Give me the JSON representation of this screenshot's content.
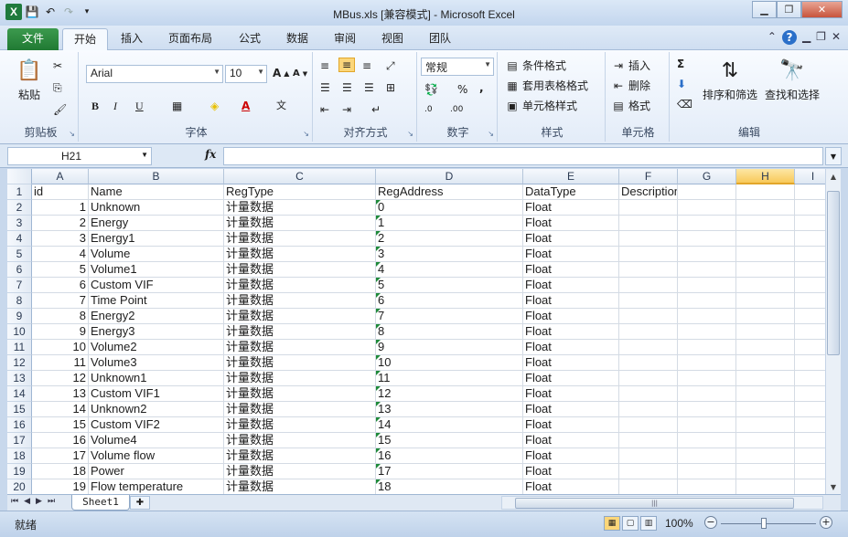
{
  "window": {
    "title": "MBus.xls  [兼容模式]  -  Microsoft Excel",
    "logo": "X"
  },
  "tabs": {
    "file": "文件",
    "items": [
      "开始",
      "插入",
      "页面布局",
      "公式",
      "数据",
      "审阅",
      "视图",
      "团队"
    ]
  },
  "ribbon": {
    "clipboard": {
      "label": "剪贴板",
      "paste": "粘贴"
    },
    "font": {
      "label": "字体",
      "name": "Arial",
      "size": "10",
      "bold": "B",
      "italic": "I",
      "underline": "U"
    },
    "alignment": {
      "label": "对齐方式"
    },
    "number": {
      "label": "数字",
      "format": "常规",
      "percent": "%",
      "comma": ","
    },
    "styles": {
      "label": "样式",
      "conditional": "条件格式",
      "table": "套用表格格式",
      "cell_styles": "单元格样式"
    },
    "cells": {
      "label": "单元格",
      "insert": "插入",
      "delete": "删除",
      "format": "格式"
    },
    "editing": {
      "label": "编辑",
      "sort": "排序和筛选",
      "find": "查找和选择"
    }
  },
  "formula_bar": {
    "name_box": "H21",
    "fx": "fx",
    "value": ""
  },
  "grid": {
    "columns": [
      "A",
      "B",
      "C",
      "D",
      "E",
      "F",
      "G",
      "H",
      "I"
    ],
    "selected_column": "H",
    "rows": [
      {
        "n": "1",
        "a": "id",
        "b": "Name",
        "c": "RegType",
        "d": "RegAddress",
        "e": "DataType",
        "f": "Description"
      },
      {
        "n": "2",
        "a": "1",
        "b": "Unknown",
        "c": "计量数据",
        "d": "0",
        "e": "Float"
      },
      {
        "n": "3",
        "a": "2",
        "b": "Energy",
        "c": "计量数据",
        "d": "1",
        "e": "Float"
      },
      {
        "n": "4",
        "a": "3",
        "b": "Energy1",
        "c": "计量数据",
        "d": "2",
        "e": "Float"
      },
      {
        "n": "5",
        "a": "4",
        "b": "Volume",
        "c": "计量数据",
        "d": "3",
        "e": "Float"
      },
      {
        "n": "6",
        "a": "5",
        "b": "Volume1",
        "c": "计量数据",
        "d": "4",
        "e": "Float"
      },
      {
        "n": "7",
        "a": "6",
        "b": "Custom VIF",
        "c": "计量数据",
        "d": "5",
        "e": "Float"
      },
      {
        "n": "8",
        "a": "7",
        "b": "Time Point",
        "c": "计量数据",
        "d": "6",
        "e": "Float"
      },
      {
        "n": "9",
        "a": "8",
        "b": "Energy2",
        "c": "计量数据",
        "d": "7",
        "e": "Float"
      },
      {
        "n": "10",
        "a": "9",
        "b": "Energy3",
        "c": "计量数据",
        "d": "8",
        "e": "Float"
      },
      {
        "n": "11",
        "a": "10",
        "b": "Volume2",
        "c": "计量数据",
        "d": "9",
        "e": "Float"
      },
      {
        "n": "12",
        "a": "11",
        "b": "Volume3",
        "c": "计量数据",
        "d": "10",
        "e": "Float"
      },
      {
        "n": "13",
        "a": "12",
        "b": "Unknown1",
        "c": "计量数据",
        "d": "11",
        "e": "Float"
      },
      {
        "n": "14",
        "a": "13",
        "b": "Custom VIF1",
        "c": "计量数据",
        "d": "12",
        "e": "Float"
      },
      {
        "n": "15",
        "a": "14",
        "b": "Unknown2",
        "c": "计量数据",
        "d": "13",
        "e": "Float"
      },
      {
        "n": "16",
        "a": "15",
        "b": "Custom VIF2",
        "c": "计量数据",
        "d": "14",
        "e": "Float"
      },
      {
        "n": "17",
        "a": "16",
        "b": "Volume4",
        "c": "计量数据",
        "d": "15",
        "e": "Float"
      },
      {
        "n": "18",
        "a": "17",
        "b": "Volume flow",
        "c": "计量数据",
        "d": "16",
        "e": "Float"
      },
      {
        "n": "19",
        "a": "18",
        "b": "Power",
        "c": "计量数据",
        "d": "17",
        "e": "Float"
      },
      {
        "n": "20",
        "a": "19",
        "b": "Flow temperature",
        "c": "计量数据",
        "d": "18",
        "e": "Float"
      }
    ]
  },
  "sheets": {
    "active": "Sheet1"
  },
  "status": {
    "ready": "就绪",
    "zoom": "100%"
  },
  "colors": {
    "accent": "#1f7a3d",
    "selected_header": "#f8c95a"
  }
}
